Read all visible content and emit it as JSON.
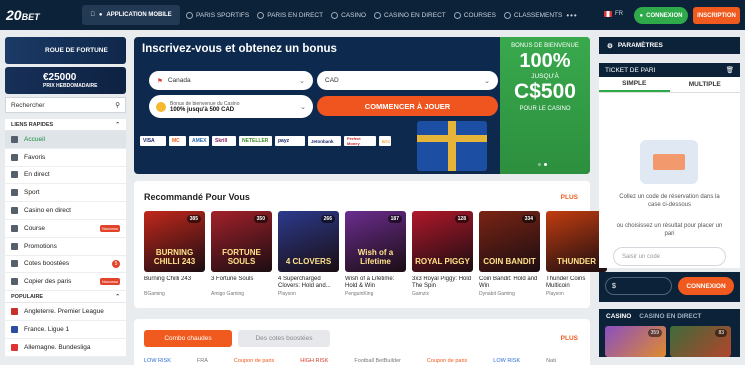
{
  "header": {
    "logo": "20",
    "logo_suffix": "BET",
    "app_button": "APPLICATION MOBILE",
    "nav": [
      "PARIS SPORTIFS",
      "PARIS EN DIRECT",
      "CASINO",
      "CASINO EN DIRECT",
      "COURSES",
      "CLASSEMENTS"
    ],
    "more": "•••",
    "lang": "FR",
    "login": "CONNEXION",
    "register": "INSCRIPTION"
  },
  "sidebar": {
    "promo1": "ROUE DE FORTUNE",
    "promo2_amount": "€25000",
    "promo2_label": "PRIX HEBDOMADAIRE",
    "search_placeholder": "Rechercher",
    "quick_links_title": "LIENS RAPIDES",
    "items": [
      {
        "label": "Accueil"
      },
      {
        "label": "Favoris"
      },
      {
        "label": "En direct"
      },
      {
        "label": "Sport"
      },
      {
        "label": "Casino en direct"
      },
      {
        "label": "Course",
        "tag": "Nouveau"
      },
      {
        "label": "Promotions"
      },
      {
        "label": "Cotes boostées",
        "count": "5"
      },
      {
        "label": "Copier des paris",
        "tag": "Nouveau"
      }
    ],
    "popular_title": "POPULAIRE",
    "popular": [
      "Angleterre. Premier League",
      "France. Ligue 1",
      "Allemagne. Bundesliga"
    ]
  },
  "hero": {
    "title": "Inscrivez-vous et obtenez un bonus",
    "country": "Canada",
    "currency": "CAD",
    "bonus_label": "Bonus de bienvenue du Casino",
    "bonus_value": "100% jusqu'à 500 CAD",
    "cta": "COMMENCER À JOUER",
    "payments": [
      "VISA",
      "MC",
      "AMEX",
      "Skrill",
      "NETELLER",
      "payz",
      "Jetonbank",
      "Perfect Money",
      "BTC"
    ],
    "side_label": "BONUS DE BIENVENUE",
    "side_percent": "100%",
    "side_upto": "JUSQU'À",
    "side_amount": "C$500",
    "side_for": "POUR LE CASINO"
  },
  "recommended": {
    "title": "Recommandé Pour Vous",
    "more": "PLUS",
    "games": [
      {
        "title": "Burning Chilli 243",
        "provider": "BGaming",
        "players": "385",
        "thumb_text": "BURNING CHILLI 243",
        "color": "#c1281c"
      },
      {
        "title": "3 Fortune Souls",
        "provider": "Amigo Gaming",
        "players": "350",
        "thumb_text": "FORTUNE SOULS",
        "color": "#a3212a"
      },
      {
        "title": "4 Supercharged Clovers: Hold and...",
        "provider": "Playson",
        "players": "266",
        "thumb_text": "4 CLOVERS",
        "color": "#2b3a8c"
      },
      {
        "title": "Wish of a Lifetime: Hold & Win",
        "provider": "PenguinKing",
        "players": "187",
        "thumb_text": "Wish of a Lifetime",
        "color": "#6b2d8f"
      },
      {
        "title": "3x3 Royal Piggy: Hold The Spin",
        "provider": "Gamzix",
        "players": "128",
        "thumb_text": "ROYAL PIGGY",
        "color": "#b0182a"
      },
      {
        "title": "Coin Bandit: Hold and Win",
        "provider": "Dynabit Gaming",
        "players": "334",
        "thumb_text": "COIN BANDIT",
        "color": "#7a2414"
      },
      {
        "title": "Thunder Coins Multicoin",
        "provider": "Playson",
        "players": "",
        "thumb_text": "THUNDER",
        "color": "#c23d10"
      }
    ]
  },
  "bets": {
    "tab_active": "Combo chaudes",
    "tab_inactive": "Des cotes boostées",
    "more": "PLUS",
    "row": [
      "LOW RISK",
      "FRA",
      "Coupon de paris",
      "HIGH RISK",
      "Football BetBuilder",
      "Coupon de paris",
      "LOW RISK",
      "Nati"
    ]
  },
  "right": {
    "settings": "PARAMÈTRES",
    "ticket_title": "TICKET DE PARI",
    "tab_simple": "SIMPLE",
    "tab_multiple": "MULTIPLE",
    "text1": "Collez un code de réservation dans la case ci-dessous",
    "text2": "ou choisissez un résultat pour placer un pari",
    "code_placeholder": "Saisir un code",
    "currency_symbol": "$",
    "login": "CONNEXION",
    "casino_tab": "CASINO",
    "casino_live_tab": "CASINO EN DIRECT",
    "casino_counts": [
      "359",
      "83"
    ]
  }
}
